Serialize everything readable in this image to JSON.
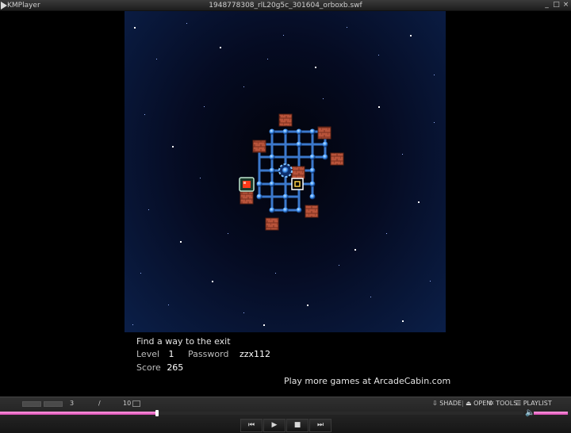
{
  "window": {
    "app_name": "KMPlayer",
    "file_name": "1948778308_rlL20g5c_301604_orboxb.swf",
    "minimize_glyph": "_",
    "maximize_glyph": "□",
    "close_glyph": "×"
  },
  "game": {
    "hint": "Find a way to the exit",
    "level_label": "Level",
    "level_value": "1",
    "password_label": "Password",
    "password_value": "zzx112",
    "score_label": "Score",
    "score_value": "265",
    "promo": "Play more games at ArcadeCabin.com"
  },
  "player": {
    "position_current": "3",
    "position_separator": "/",
    "position_total": "10",
    "buttons": {
      "shade": "SHADE",
      "open": "OPEN",
      "tools": "TOOLS",
      "playlist": "PLAYLIST"
    },
    "seek_progress": 0.3,
    "volume_level": 0.95,
    "transport": {
      "prev": "⏮",
      "play": "▶",
      "stop": "■",
      "next": "⏭"
    }
  },
  "colors": {
    "accent_pink": "#e05bc0",
    "grid_blue": "#3f7fd6",
    "brick_red": "#b8533a",
    "space_blue": "#0b1f48"
  }
}
